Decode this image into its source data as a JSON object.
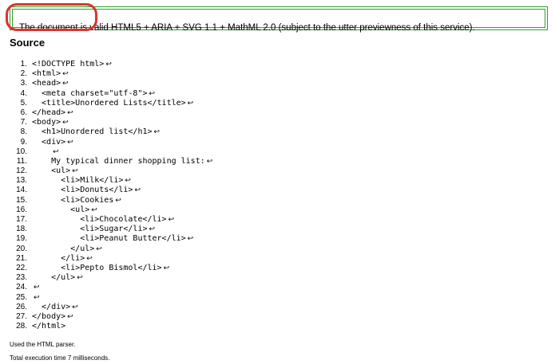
{
  "result": {
    "message": "The document is valid HTML5 + ARIA + SVG 1.1 + MathML 2.0 (subject to the utter previewness of this service).",
    "border_color": "#2e9e2e",
    "highlight_color": "#d9352e"
  },
  "source": {
    "heading": "Source",
    "line_break_symbol": "↩",
    "lines": [
      {
        "number": "1.",
        "code": "<!DOCTYPE html>",
        "break": true
      },
      {
        "number": "2.",
        "code": "<html>",
        "break": true
      },
      {
        "number": "3.",
        "code": "<head>",
        "break": true
      },
      {
        "number": "4.",
        "code": "  <meta charset=\"utf-8\">",
        "break": true
      },
      {
        "number": "5.",
        "code": "  <title>Unordered Lists</title>",
        "break": true
      },
      {
        "number": "6.",
        "code": "</head>",
        "break": true
      },
      {
        "number": "7.",
        "code": "<body>",
        "break": true
      },
      {
        "number": "8.",
        "code": "  <h1>Unordered list</h1>",
        "break": true
      },
      {
        "number": "9.",
        "code": "  <div>",
        "break": true
      },
      {
        "number": "10.",
        "code": "    ",
        "break": true
      },
      {
        "number": "11.",
        "code": "    My typical dinner shopping list:",
        "break": true
      },
      {
        "number": "12.",
        "code": "    <ul>",
        "break": true
      },
      {
        "number": "13.",
        "code": "      <li>Milk</li>",
        "break": true
      },
      {
        "number": "14.",
        "code": "      <li>Donuts</li>",
        "break": true
      },
      {
        "number": "15.",
        "code": "      <li>Cookies",
        "break": true
      },
      {
        "number": "16.",
        "code": "        <ul>",
        "break": true
      },
      {
        "number": "17.",
        "code": "          <li>Chocolate</li>",
        "break": true
      },
      {
        "number": "18.",
        "code": "          <li>Sugar</li>",
        "break": true
      },
      {
        "number": "19.",
        "code": "          <li>Peanut Butter</li>",
        "break": true
      },
      {
        "number": "20.",
        "code": "        </ul>",
        "break": true
      },
      {
        "number": "21.",
        "code": "      </li>",
        "break": true
      },
      {
        "number": "22.",
        "code": "      <li>Pepto Bismol</li>",
        "break": true
      },
      {
        "number": "23.",
        "code": "    </ul>",
        "break": true
      },
      {
        "number": "24.",
        "code": "",
        "break": true
      },
      {
        "number": "25.",
        "code": "",
        "break": true
      },
      {
        "number": "26.",
        "code": "  </div>",
        "break": true
      },
      {
        "number": "27.",
        "code": "</body>",
        "break": true
      },
      {
        "number": "28.",
        "code": "</html>",
        "break": false
      }
    ]
  },
  "footer": {
    "parser_note": "Used the HTML parser.",
    "execution_time": "Total execution time 7 milliseconds."
  }
}
